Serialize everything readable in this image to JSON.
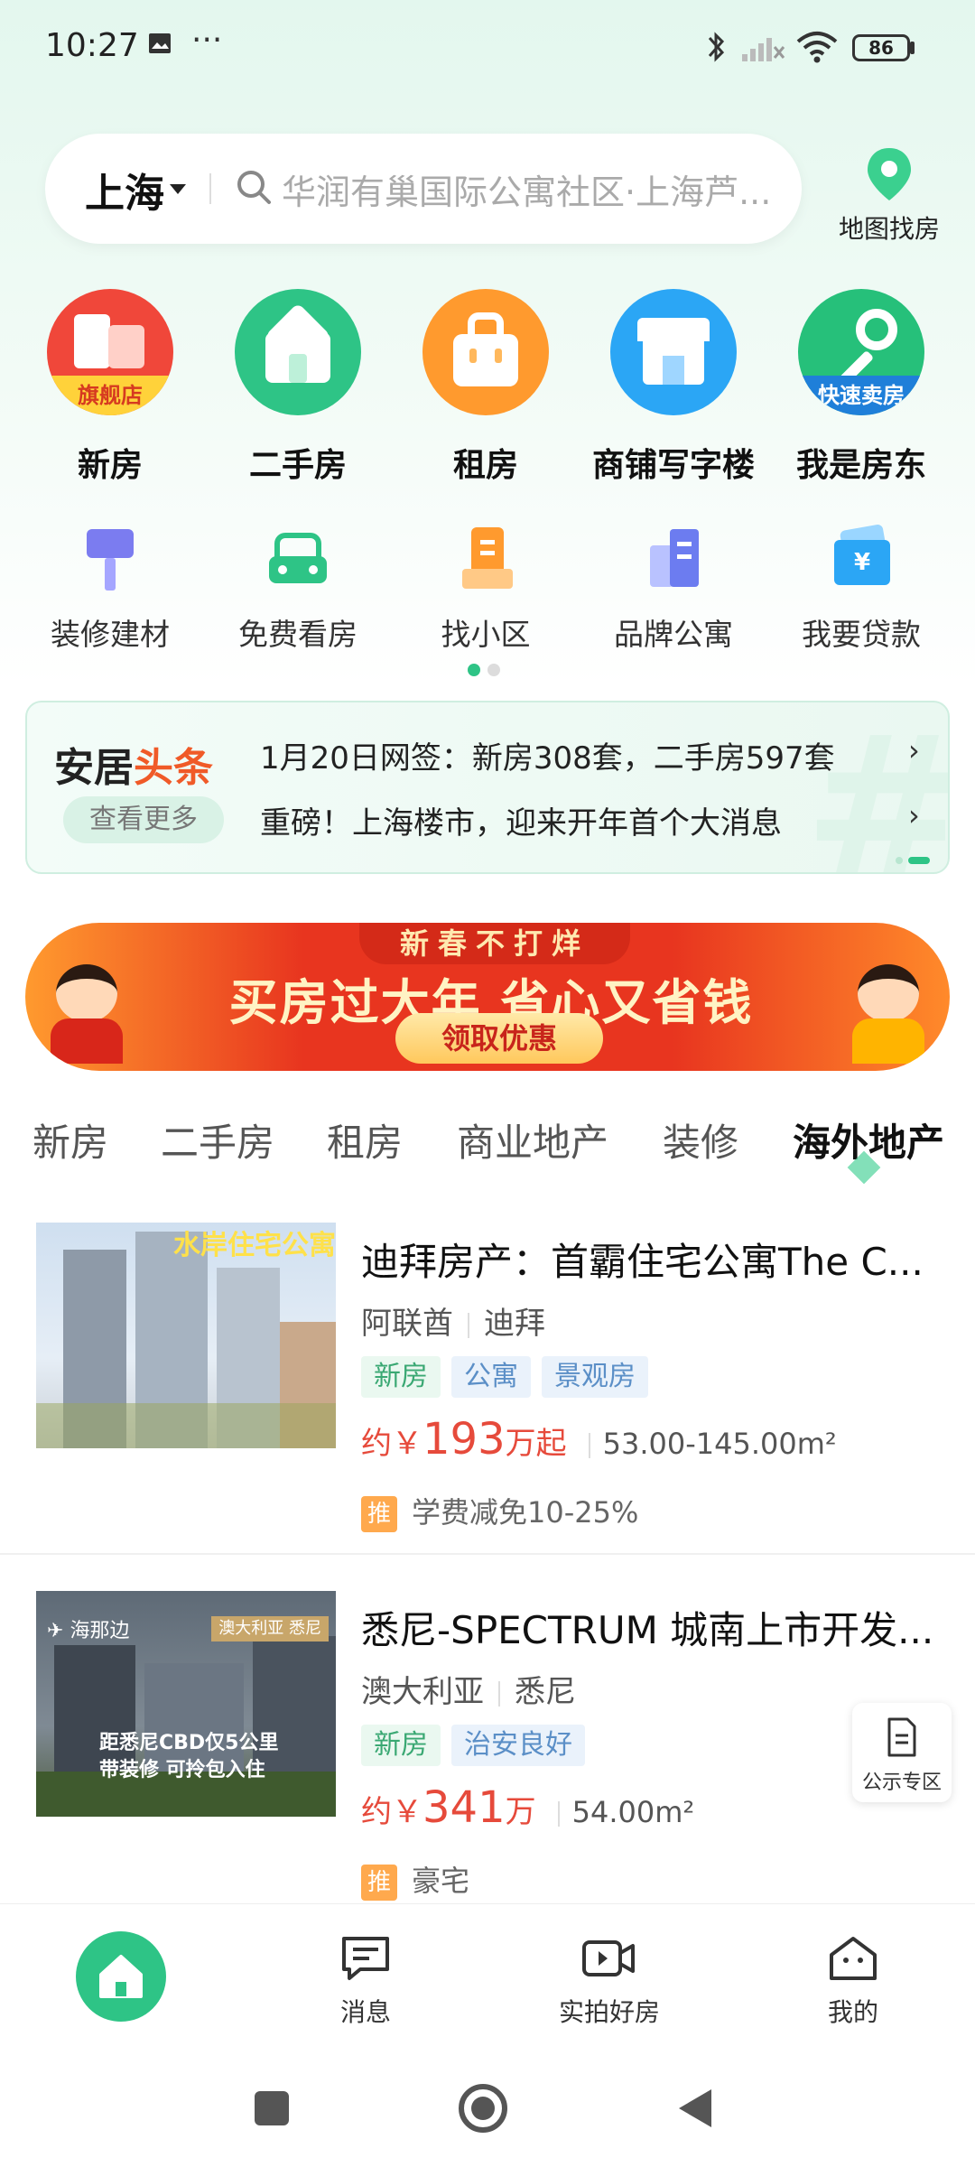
{
  "status_bar": {
    "time": "10:27",
    "battery": "86"
  },
  "search": {
    "city": "上海",
    "placeholder": "华润有巢国际公寓社区·上海芦..."
  },
  "map_button": {
    "label": "地图找房"
  },
  "primary_nav": [
    {
      "label": "新房",
      "ribbon": "旗舰店",
      "color": "#f0473a"
    },
    {
      "label": "二手房",
      "color": "#2ec486"
    },
    {
      "label": "租房",
      "color": "#ff9a2e"
    },
    {
      "label": "商铺写字楼",
      "color": "#2ba6f5"
    },
    {
      "label": "我是房东",
      "ribbon": "快速卖房",
      "color": "#26c07a"
    }
  ],
  "secondary_nav": [
    {
      "label": "装修建材"
    },
    {
      "label": "免费看房"
    },
    {
      "label": "找小区"
    },
    {
      "label": "品牌公寓"
    },
    {
      "label": "我要贷款"
    }
  ],
  "news": {
    "logo_a": "安居",
    "logo_b": "头条",
    "more": "查看更多",
    "line1": "1月20日网签：新房308套，二手房597套",
    "line2": "重磅！上海楼市，迎来开年首个大消息",
    "arrow": "›"
  },
  "banner": {
    "top": "新春不打烊",
    "main": "买房过大年 省心又省钱",
    "button": "领取优惠"
  },
  "tabs": [
    "新房",
    "二手房",
    "租房",
    "商业地产",
    "装修",
    "海外地产"
  ],
  "active_tab": "海外地产",
  "listings": [
    {
      "title": "迪拜房产：首霸住宅公寓The C...",
      "country": "阿联酋",
      "city": "迪拜",
      "tags": [
        "新房",
        "公寓",
        "景观房"
      ],
      "price_prefix": "约￥",
      "price": "193",
      "price_suffix": "万起",
      "area": "53.00-145.00m²",
      "promo_badge": "推",
      "promo": "学费减免10-25%",
      "thumb_text": "水岸住宅公寓"
    },
    {
      "title": "悉尼-SPECTRUM 城南上市开发...",
      "country": "澳大利亚",
      "city": "悉尼",
      "tags": [
        "新房",
        "治安良好"
      ],
      "price_prefix": "约￥",
      "price": "341",
      "price_suffix": "万",
      "area": "54.00m²",
      "promo_badge": "推",
      "promo": "豪宅",
      "thumb_brand": "海那边",
      "thumb_tag": "澳大利亚 悉尼",
      "thumb_line1": "距悉尼CBD仅5公里",
      "thumb_line2": "带装修 可拎包入住"
    }
  ],
  "public_zone": {
    "label": "公示专区"
  },
  "bottom_nav": [
    {
      "label": ""
    },
    {
      "label": "消息"
    },
    {
      "label": "实拍好房"
    },
    {
      "label": "我的"
    }
  ],
  "colors": {
    "brand_green": "#2ec486",
    "price_red": "#e64a3b"
  }
}
